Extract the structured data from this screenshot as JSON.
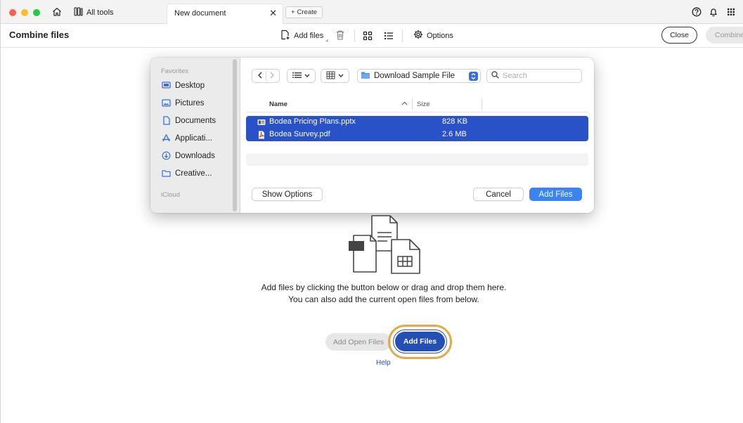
{
  "window": {
    "all_tools_label": "All tools",
    "tab_label": "New document",
    "create_label": "Create",
    "traffic_colors": [
      "#fe5f57",
      "#febc2e",
      "#28c840"
    ],
    "icons": [
      "home-icon",
      "all-tools-icon",
      "close-icon",
      "plus-icon",
      "help-icon",
      "bell-icon",
      "apps-grid-icon"
    ]
  },
  "toolbar": {
    "title": "Combine files",
    "add_files_label": "Add files",
    "options_label": "Options",
    "close_label": "Close",
    "combine_label": "Combine"
  },
  "dialog": {
    "sidebar": {
      "favorites_heading": "Favorites",
      "items": [
        {
          "label": "Desktop",
          "icon": "desktop-icon"
        },
        {
          "label": "Pictures",
          "icon": "pictures-icon"
        },
        {
          "label": "Documents",
          "icon": "documents-icon"
        },
        {
          "label": "Applicati...",
          "icon": "applications-icon"
        },
        {
          "label": "Downloads",
          "icon": "downloads-icon"
        },
        {
          "label": "Creative...",
          "icon": "folder-icon"
        }
      ],
      "icloud_heading": "iCloud"
    },
    "location": "Download Sample File",
    "search_placeholder": "Search",
    "columns": {
      "name": "Name",
      "size": "Size"
    },
    "files": [
      {
        "name": "Bodea Pricing Plans.pptx",
        "size": "828 KB",
        "icon": "pptx-file-icon"
      },
      {
        "name": "Bodea Survey.pdf",
        "size": "2.6 MB",
        "icon": "pdf-file-icon"
      }
    ],
    "show_options_label": "Show Options",
    "cancel_label": "Cancel",
    "add_files_label": "Add Files",
    "selection_color": "#2a52c8",
    "accent_color": "#3b83f0"
  },
  "main": {
    "instruction_line1": "Add files by clicking the button below or drag and drop them here.",
    "instruction_line2": "You can also add the current open files from below.",
    "add_open_files_label": "Add Open Files",
    "add_files_label": "Add Files",
    "help_label": "Help",
    "highlight_color": "#e1aa4d",
    "button_color": "#2450b3"
  }
}
